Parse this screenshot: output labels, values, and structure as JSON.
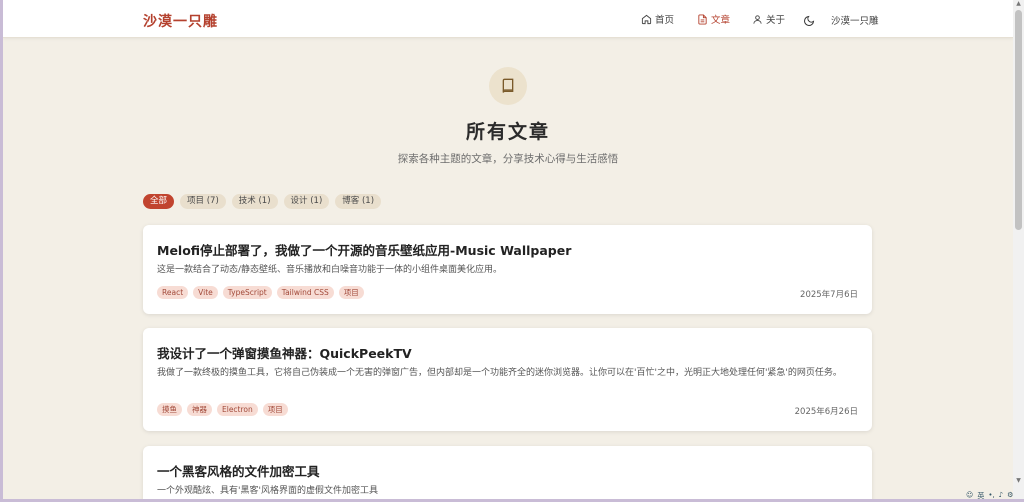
{
  "header": {
    "logo": "沙漠一只雕",
    "nav": [
      {
        "label": "首页",
        "icon": "home-icon",
        "active": false
      },
      {
        "label": "文章",
        "icon": "document-icon",
        "active": true
      },
      {
        "label": "关于",
        "icon": "user-icon",
        "active": false
      }
    ],
    "theme_icon": "moon-icon",
    "user_label": "沙漠一只雕"
  },
  "hero": {
    "icon": "book-icon",
    "title": "所有文章",
    "subtitle": "探索各种主题的文章，分享技术心得与生活感悟"
  },
  "filters": [
    "全部",
    "项目 (7)",
    "技术 (1)",
    "设计 (1)",
    "博客 (1)"
  ],
  "articles": [
    {
      "title": "Melofi停止部署了，我做了一个开源的音乐壁纸应用-Music Wallpaper",
      "description": "这是一款结合了动态/静态壁纸、音乐播放和白噪音功能于一体的小组件桌面美化应用。",
      "tags": [
        "React",
        "Vite",
        "TypeScript",
        "Tailwind CSS",
        "项目"
      ],
      "date": "2025年7月6日"
    },
    {
      "title": "我设计了一个弹窗摸鱼神器：QuickPeekTV",
      "description": "我做了一款终极的摸鱼工具，它将自己伪装成一个无害的弹窗广告，但内部却是一个功能齐全的迷你浏览器。让你可以在'百忙'之中，光明正大地处理任何'紧急'的网页任务。",
      "tags": [
        "摸鱼",
        "神器",
        "Electron",
        "项目"
      ],
      "date": "2025年6月26日"
    },
    {
      "title": "一个黑客风格的文件加密工具",
      "description": "一个外观酷炫、具有'黑客'风格界面的虚假文件加密工具",
      "tags": [],
      "date": ""
    }
  ],
  "colors": {
    "accent": "#c1442f",
    "background": "#f3efe6",
    "tag_bg": "#f7dcd4"
  }
}
